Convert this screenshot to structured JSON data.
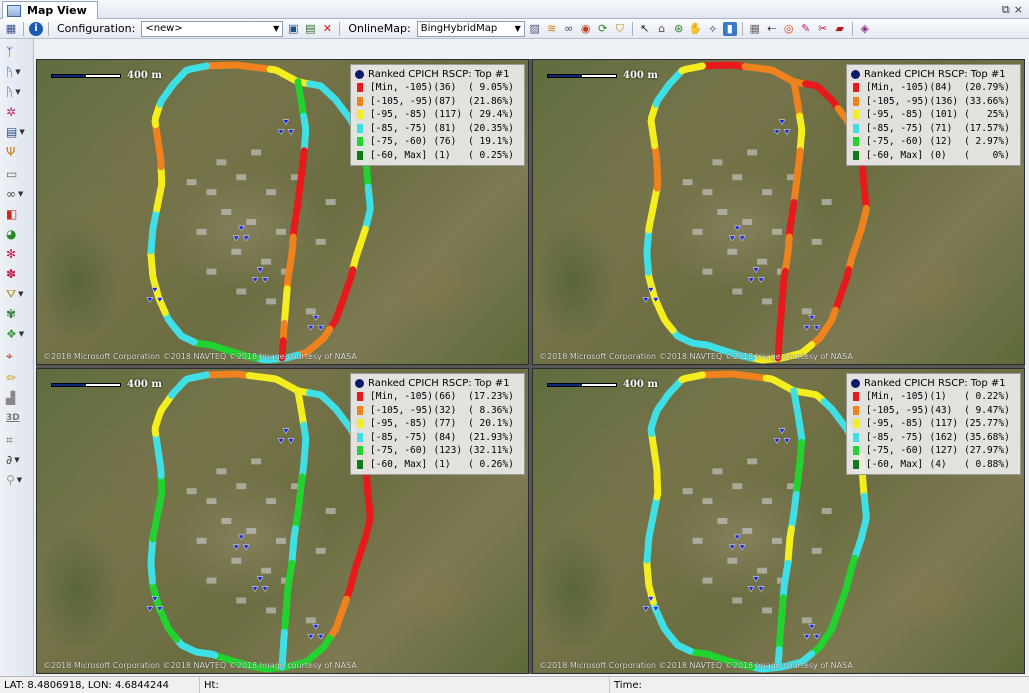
{
  "window": {
    "title": "Map View",
    "controls": [
      "⧉",
      "×"
    ]
  },
  "toolbar": {
    "config_label": "Configuration:",
    "config_value": "<new>",
    "online_map_label": "OnlineMap:",
    "online_map_value": "BingHybridMap"
  },
  "panels": [
    {
      "scale_label": "400 m",
      "copyright": "©2018 Microsoft Corporation ©2018 NAVTEQ ©2018 Image courtesy of NASA",
      "legend": {
        "title": "Ranked CPICH RSCP: Top #1",
        "rows": [
          {
            "range": "[Min, -105)",
            "count": "(36)",
            "percent": "( 9.05%)",
            "color": "#e8191b"
          },
          {
            "range": "[-105, -95)",
            "count": "(87)",
            "percent": "(21.86%)",
            "color": "#f0821e"
          },
          {
            "range": "[-95, -85)",
            "count": "(117)",
            "percent": "( 29.4%)",
            "color": "#f5ee1e"
          },
          {
            "range": "[-85, -75)",
            "count": "(81)",
            "percent": "(20.35%)",
            "color": "#3ee0e6"
          },
          {
            "range": "[-75, -60)",
            "count": "(76)",
            "percent": "( 19.1%)",
            "color": "#22d22e"
          },
          {
            "range": "[-60, Max]",
            "count": "(1)",
            "percent": "( 0.25%)",
            "color": "#0e7a1a"
          }
        ]
      }
    },
    {
      "scale_label": "400 m",
      "copyright": "©2018 Microsoft Corporation ©2018 NAVTEQ ©2018 Image courtesy of NASA",
      "legend": {
        "title": "Ranked CPICH RSCP: Top #1",
        "rows": [
          {
            "range": "[Min, -105)",
            "count": "(84)",
            "percent": "(20.79%)",
            "color": "#e8191b"
          },
          {
            "range": "[-105, -95)",
            "count": "(136)",
            "percent": "(33.66%)",
            "color": "#f0821e"
          },
          {
            "range": "[-95, -85)",
            "count": "(101)",
            "percent": "(   25%)",
            "color": "#f5ee1e"
          },
          {
            "range": "[-85, -75)",
            "count": "(71)",
            "percent": "(17.57%)",
            "color": "#3ee0e6"
          },
          {
            "range": "[-75, -60)",
            "count": "(12)",
            "percent": "( 2.97%)",
            "color": "#22d22e"
          },
          {
            "range": "[-60, Max]",
            "count": "(0)",
            "percent": "(    0%)",
            "color": "#0e7a1a"
          }
        ]
      }
    },
    {
      "scale_label": "400 m",
      "copyright": "©2018 Microsoft Corporation ©2018 NAVTEQ ©2018 Image courtesy of NASA",
      "legend": {
        "title": "Ranked CPICH RSCP: Top #1",
        "rows": [
          {
            "range": "[Min, -105)",
            "count": "(66)",
            "percent": "(17.23%)",
            "color": "#e8191b"
          },
          {
            "range": "[-105, -95)",
            "count": "(32)",
            "percent": "( 8.36%)",
            "color": "#f0821e"
          },
          {
            "range": "[-95, -85)",
            "count": "(77)",
            "percent": "( 20.1%)",
            "color": "#f5ee1e"
          },
          {
            "range": "[-85, -75)",
            "count": "(84)",
            "percent": "(21.93%)",
            "color": "#3ee0e6"
          },
          {
            "range": "[-75, -60)",
            "count": "(123)",
            "percent": "(32.11%)",
            "color": "#22d22e"
          },
          {
            "range": "[-60, Max]",
            "count": "(1)",
            "percent": "( 0.26%)",
            "color": "#0e7a1a"
          }
        ]
      }
    },
    {
      "scale_label": "400 m",
      "copyright": "©2018 Microsoft Corporation ©2018 NAVTEQ ©2018 Image courtesy of NASA",
      "legend": {
        "title": "Ranked CPICH RSCP: Top #1",
        "rows": [
          {
            "range": "[Min, -105)",
            "count": "(1)",
            "percent": "( 0.22%)",
            "color": "#e8191b"
          },
          {
            "range": "[-105, -95)",
            "count": "(43)",
            "percent": "( 9.47%)",
            "color": "#f0821e"
          },
          {
            "range": "[-95, -85)",
            "count": "(117)",
            "percent": "(25.77%)",
            "color": "#f5ee1e"
          },
          {
            "range": "[-85, -75)",
            "count": "(162)",
            "percent": "(35.68%)",
            "color": "#3ee0e6"
          },
          {
            "range": "[-75, -60)",
            "count": "(127)",
            "percent": "(27.97%)",
            "color": "#22d22e"
          },
          {
            "range": "[-60, Max]",
            "count": "(4)",
            "percent": "( 0.88%)",
            "color": "#0e7a1a"
          }
        ]
      }
    }
  ],
  "status": {
    "coords": "LAT: 8.4806918, LON: 4.6844244",
    "height_label": "Ht:",
    "time_label": "Time:"
  }
}
